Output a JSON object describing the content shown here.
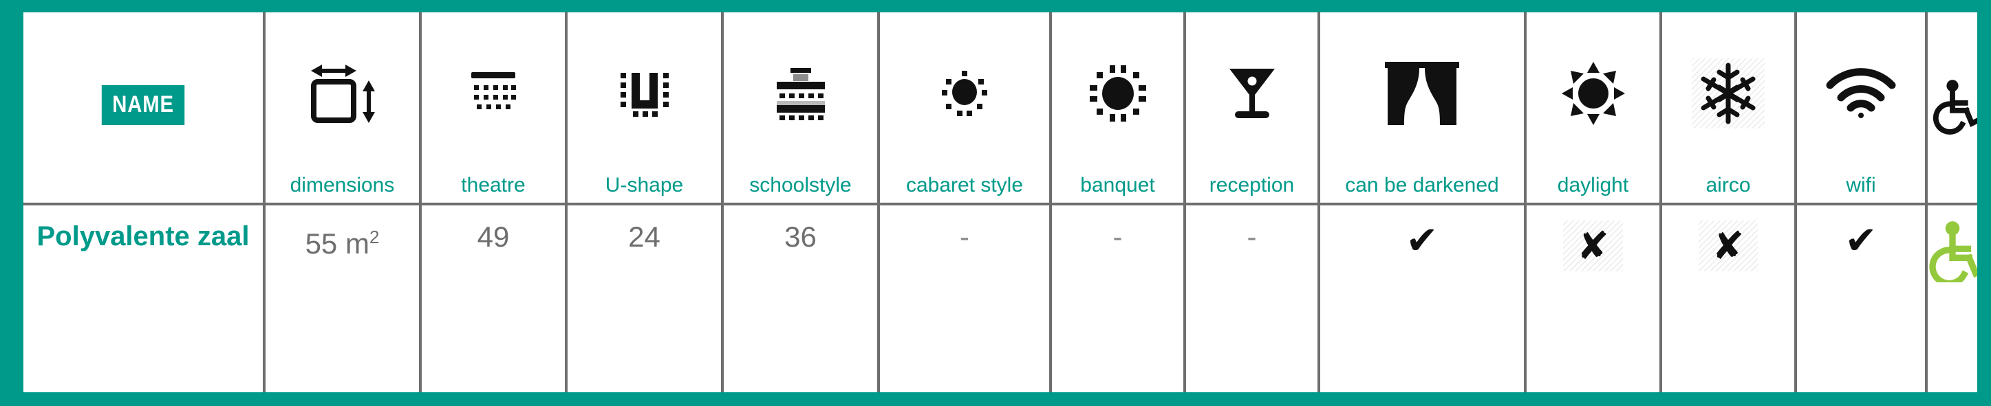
{
  "colors": {
    "brand_teal": "#009a8a",
    "divider_gray": "#6e6e6e",
    "value_gray": "#6e6e6e",
    "icon_black": "#111111",
    "accessible_green": "#95c93d",
    "badge_text": "#ffffff"
  },
  "header": {
    "name_badge_label": "NAME",
    "columns": [
      {
        "key": "name",
        "icon": "name-badge",
        "label": ""
      },
      {
        "key": "dimensions",
        "icon": "dimensions-icon",
        "label": "dimensions"
      },
      {
        "key": "theatre",
        "icon": "theatre-icon",
        "label": "theatre"
      },
      {
        "key": "ushape",
        "icon": "u-shape-icon",
        "label": "U-shape"
      },
      {
        "key": "schoolstyle",
        "icon": "schoolstyle-icon",
        "label": "schoolstyle"
      },
      {
        "key": "cabaret",
        "icon": "cabaret-style-icon",
        "label": "cabaret style"
      },
      {
        "key": "banquet",
        "icon": "banquet-icon",
        "label": "banquet"
      },
      {
        "key": "reception",
        "icon": "reception-icon",
        "label": "reception"
      },
      {
        "key": "darkened",
        "icon": "curtain-icon",
        "label": "can be darkened"
      },
      {
        "key": "daylight",
        "icon": "sun-icon",
        "label": "daylight"
      },
      {
        "key": "airco",
        "icon": "snowflake-icon",
        "label": "airco"
      },
      {
        "key": "wifi",
        "icon": "wifi-icon",
        "label": "wifi"
      },
      {
        "key": "accessible",
        "icon": "wheelchair-icon",
        "label": ""
      }
    ]
  },
  "rows": [
    {
      "name": "Polyvalente zaal",
      "dimensions_value": "55 m",
      "dimensions_exponent": "2",
      "theatre": "49",
      "ushape": "24",
      "schoolstyle": "36",
      "cabaret": "-",
      "banquet": "-",
      "reception": "-",
      "darkened": "✔",
      "daylight": "✘",
      "airco": "✘",
      "wifi": "✔",
      "accessible": "wheelchair-icon"
    }
  ]
}
